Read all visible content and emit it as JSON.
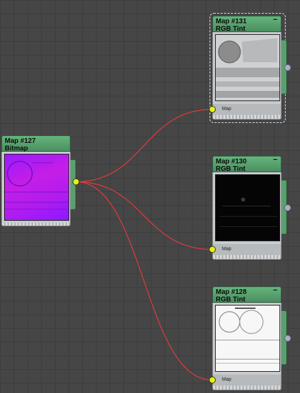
{
  "nodes": {
    "map127": {
      "id": "Map #127",
      "type": "Bitmap"
    },
    "map131": {
      "id": "Map #131",
      "type": "RGB Tint",
      "minimize": "−",
      "port_label": "Map"
    },
    "map130": {
      "id": "Map #130",
      "type": "RGB Tint",
      "minimize": "−",
      "port_label": "Map"
    },
    "map128": {
      "id": "Map #128",
      "type": "RGB Tint",
      "minimize": "−",
      "port_label": "Map"
    }
  },
  "colors": {
    "canvas": "#464646",
    "node_header": "#5aa06e",
    "wire": "#e23a3a",
    "socket_input": "#e5f11e",
    "socket_output": "#a9b2c5"
  }
}
